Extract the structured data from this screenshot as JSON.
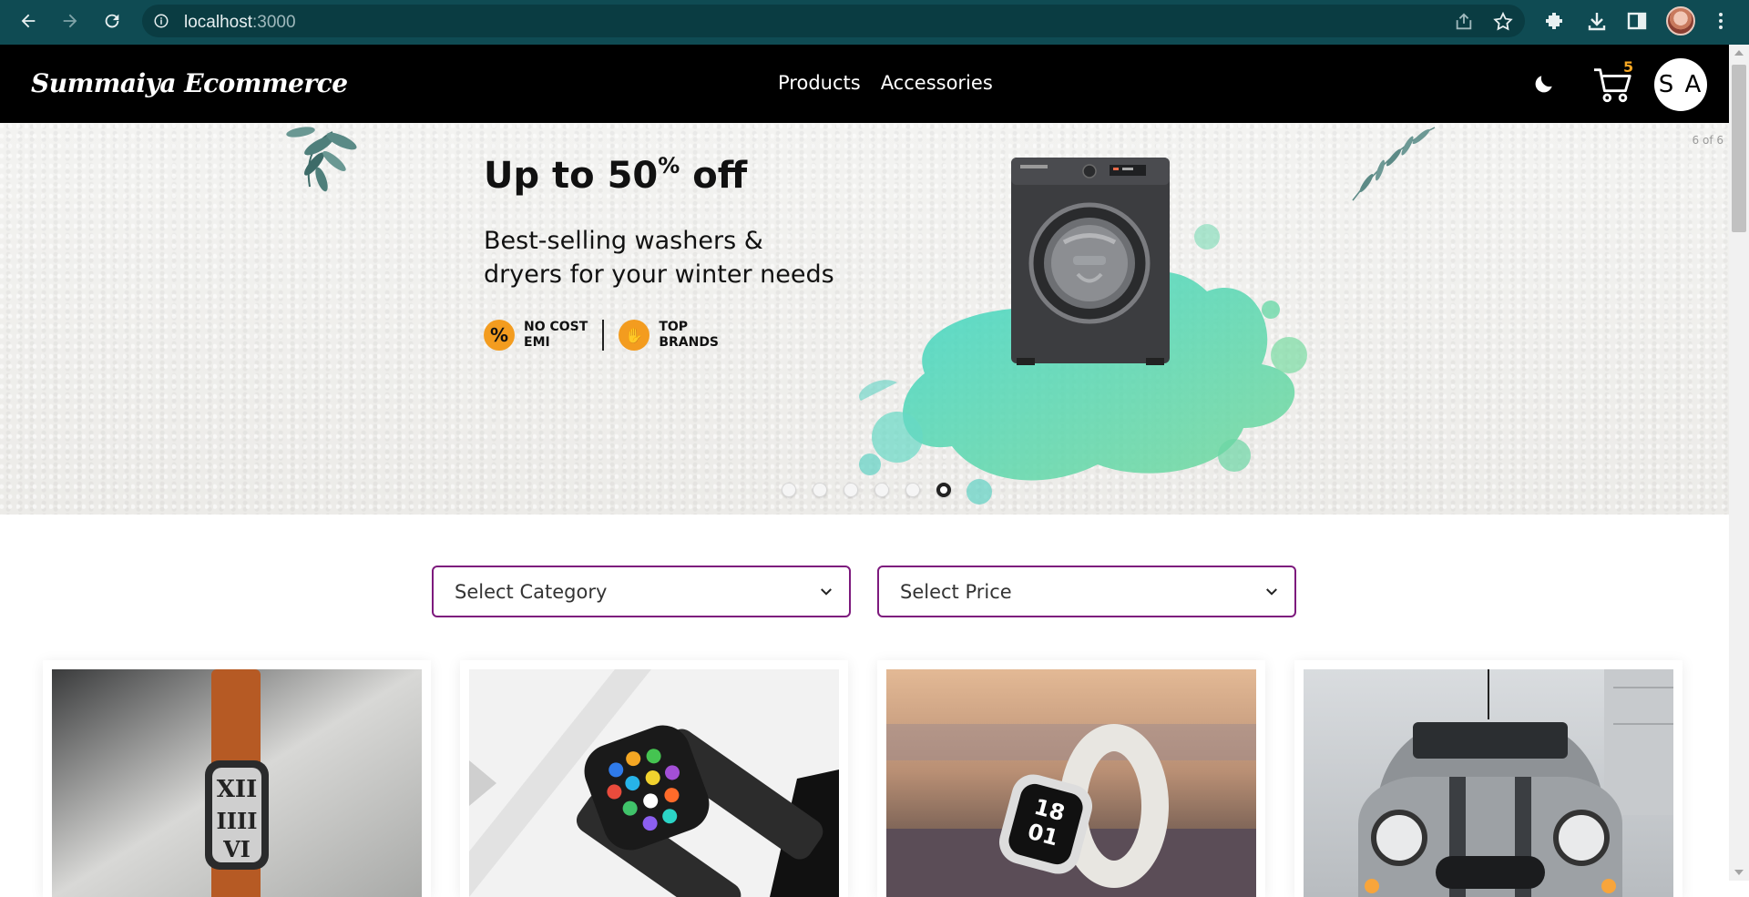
{
  "browser": {
    "url_host": "localhost",
    "url_port": ":3000"
  },
  "navbar": {
    "logo": "Summaiya Ecommerce",
    "links": [
      "Products",
      "Accessories"
    ],
    "cart_count": "5",
    "avatar_initials": "S A"
  },
  "hero": {
    "slide_counter": "6 of 6",
    "title_main": "Up to 50",
    "title_sup": "%",
    "title_end": " off",
    "subtitle_line1": "Best-selling washers &",
    "subtitle_line2": "dryers for your winter needs",
    "badges": [
      {
        "icon": "%",
        "line1": "NO COST",
        "line2": "EMI"
      },
      {
        "icon": "✋",
        "line1": "TOP",
        "line2": "BRANDS"
      }
    ],
    "dot_count": 6,
    "active_dot_index": 5
  },
  "filters": {
    "category_label": "Select Category",
    "price_label": "Select Price"
  },
  "products": [
    {
      "image": "smartwatch-orange-band"
    },
    {
      "image": "apple-watch-black-band"
    },
    {
      "image": "smartwatch-white-band"
    },
    {
      "image": "mini-cooper-car"
    }
  ],
  "colors": {
    "chrome_bg": "#0f4b53",
    "navbar_bg": "#000000",
    "select_border": "#7d1a7d",
    "cart_count": "#f5a623",
    "badge_orange": "#f39c1f"
  }
}
